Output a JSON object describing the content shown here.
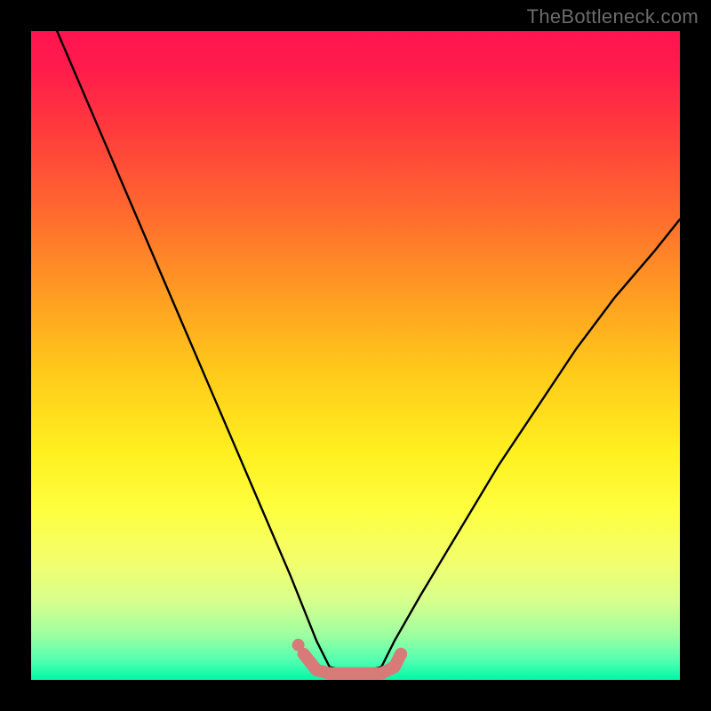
{
  "watermark": "TheBottleneck.com",
  "chart_data": {
    "type": "line",
    "title": "",
    "xlabel": "",
    "ylabel": "",
    "xlim": [
      0,
      100
    ],
    "ylim": [
      0,
      100
    ],
    "grid": false,
    "legend": false,
    "description": "V-shaped bottleneck curve over a vertical red-to-green gradient. Y represents bottleneck percentage (100 = severe/red at top, 0 = none/green at bottom). X represents component balance; the minimum (flat valley) around x≈44–55 indicates an optimally balanced configuration.",
    "series": [
      {
        "name": "bottleneck-curve",
        "color": "#000000",
        "x": [
          4,
          10,
          16,
          22,
          28,
          34,
          40,
          44,
          46,
          50,
          54,
          56,
          60,
          66,
          72,
          78,
          84,
          90,
          96,
          100
        ],
        "y": [
          100,
          86,
          72,
          58,
          44,
          30,
          16,
          6,
          2,
          1,
          2,
          6,
          13,
          23,
          33,
          42,
          51,
          59,
          66,
          71
        ]
      },
      {
        "name": "optimal-range-marker",
        "color": "#d87a78",
        "x": [
          42,
          44,
          46,
          48,
          50,
          52,
          54,
          56,
          57
        ],
        "y": [
          4,
          1.5,
          1,
          1,
          1,
          1,
          1,
          2,
          4
        ]
      }
    ],
    "gradient_stops": [
      {
        "pos": 0,
        "color": "#ff1450"
      },
      {
        "pos": 15,
        "color": "#ff3a3d"
      },
      {
        "pos": 40,
        "color": "#ff9a22"
      },
      {
        "pos": 65,
        "color": "#fff020"
      },
      {
        "pos": 88,
        "color": "#d6ff8e"
      },
      {
        "pos": 100,
        "color": "#00f8a8"
      }
    ]
  }
}
